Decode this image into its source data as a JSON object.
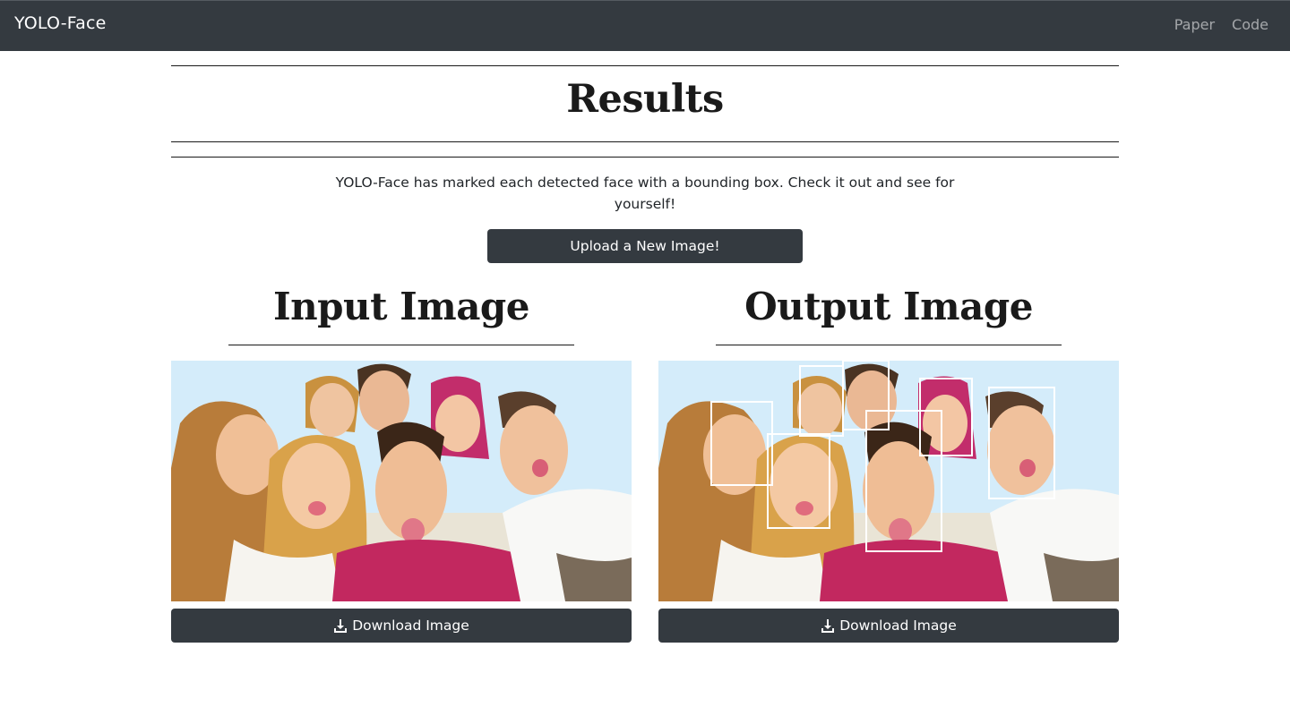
{
  "navbar": {
    "brand": "YOLO-Face",
    "links": [
      {
        "label": "Paper"
      },
      {
        "label": "Code"
      }
    ]
  },
  "page": {
    "title": "Results",
    "description": "YOLO-Face has marked each detected face with a bounding box. Check it out and see for yourself!",
    "upload_button": "Upload a New Image!"
  },
  "input_panel": {
    "title": "Input Image",
    "download_label": "Download Image",
    "download_icon": "download-icon",
    "image_description": "group selfie photo"
  },
  "output_panel": {
    "title": "Output Image",
    "download_label": "Download Image",
    "download_icon": "download-icon",
    "image_description": "group selfie photo with face bounding boxes",
    "box_color": "#ffffff"
  },
  "colors": {
    "navbar_bg": "#343a40",
    "button_bg": "#343a40",
    "nav_link": "rgba(255,255,255,0.55)"
  }
}
